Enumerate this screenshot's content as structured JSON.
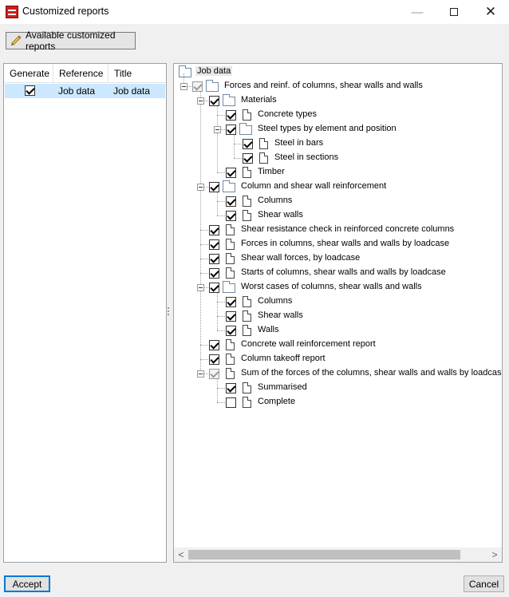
{
  "window": {
    "title": "Customized reports",
    "minimize": "—",
    "close": "✕"
  },
  "toolbar": {
    "available_reports_label": "Available customized reports",
    "icon": "pencil-icon"
  },
  "grid": {
    "columns": [
      "Generate",
      "Reference",
      "Title"
    ],
    "rows": [
      {
        "generate": true,
        "reference": "Job data",
        "title": "Job data"
      }
    ]
  },
  "tree": {
    "root": "Job data",
    "items": [
      {
        "label": "Forces and reinf. of columns, shear walls and walls",
        "level": 1,
        "icon": "folder-icon",
        "state": "indeterminate",
        "expander": true
      },
      {
        "label": "Materials",
        "level": 2,
        "icon": "folder-icon",
        "state": "checked",
        "expander": true
      },
      {
        "label": "Concrete types",
        "level": 3,
        "icon": "document-icon",
        "state": "checked"
      },
      {
        "label": "Steel types by element and position",
        "level": 3,
        "icon": "folder-icon",
        "state": "checked",
        "expander": true
      },
      {
        "label": "Steel in bars",
        "level": 4,
        "icon": "document-icon",
        "state": "checked"
      },
      {
        "label": "Steel in sections",
        "level": 4,
        "icon": "document-icon",
        "state": "checked"
      },
      {
        "label": "Timber",
        "level": 3,
        "icon": "document-icon",
        "state": "checked"
      },
      {
        "label": "Column and shear wall reinforcement",
        "level": 2,
        "icon": "folder-icon",
        "state": "checked",
        "expander": true
      },
      {
        "label": "Columns",
        "level": 3,
        "icon": "document-icon",
        "state": "checked"
      },
      {
        "label": "Shear walls",
        "level": 3,
        "icon": "document-icon",
        "state": "checked"
      },
      {
        "label": "Shear resistance check in reinforced concrete columns",
        "level": 2,
        "icon": "document-icon",
        "state": "checked"
      },
      {
        "label": "Forces in columns, shear walls and walls by loadcase",
        "level": 2,
        "icon": "document-icon",
        "state": "checked"
      },
      {
        "label": "Shear wall forces, by loadcase",
        "level": 2,
        "icon": "document-icon",
        "state": "checked"
      },
      {
        "label": "Starts of columns, shear walls and walls by loadcase",
        "level": 2,
        "icon": "document-icon",
        "state": "checked"
      },
      {
        "label": "Worst cases of columns, shear walls and walls",
        "level": 2,
        "icon": "folder-icon",
        "state": "checked",
        "expander": true
      },
      {
        "label": "Columns",
        "level": 3,
        "icon": "document-icon",
        "state": "checked"
      },
      {
        "label": "Shear walls",
        "level": 3,
        "icon": "document-icon",
        "state": "checked"
      },
      {
        "label": "Walls",
        "level": 3,
        "icon": "document-icon",
        "state": "checked"
      },
      {
        "label": "Concrete wall reinforcement report",
        "level": 2,
        "icon": "document-icon",
        "state": "checked"
      },
      {
        "label": "Column takeoff report",
        "level": 2,
        "icon": "document-icon",
        "state": "checked"
      },
      {
        "label": "Sum of the forces of the columns, shear walls and walls by loadcase and",
        "level": 2,
        "icon": "document-icon",
        "state": "indeterminate",
        "expander": true
      },
      {
        "label": "Summarised",
        "level": 3,
        "icon": "document-icon",
        "state": "checked"
      },
      {
        "label": "Complete",
        "level": 3,
        "icon": "document-icon",
        "state": "unchecked"
      }
    ]
  },
  "scrollbar": {
    "left_arrow": "<",
    "right_arrow": ">"
  },
  "buttons": {
    "accept": "Accept",
    "cancel": "Cancel"
  }
}
